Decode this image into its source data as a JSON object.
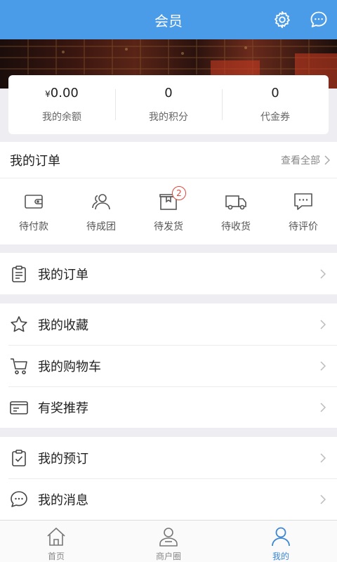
{
  "header": {
    "title": "会员",
    "settings_icon": "gear-icon",
    "message_icon": "chat-bubble-icon",
    "bg_color": "#4a9be8"
  },
  "account": {
    "balance": {
      "currency": "¥",
      "value": "0.00",
      "label": "我的余额"
    },
    "points": {
      "value": "0",
      "label": "我的积分"
    },
    "vouchers": {
      "value": "0",
      "label": "代金券"
    }
  },
  "orders": {
    "title": "我的订单",
    "view_all": "查看全部",
    "statuses": [
      {
        "label": "待付款",
        "icon": "wallet-icon"
      },
      {
        "label": "待成团",
        "icon": "group-icon"
      },
      {
        "label": "待发货",
        "icon": "package-icon",
        "badge": "2"
      },
      {
        "label": "待收货",
        "icon": "truck-icon"
      },
      {
        "label": "待评价",
        "icon": "comment-icon"
      }
    ]
  },
  "menu": {
    "my_orders": "我的订单",
    "favorites": "我的收藏",
    "cart": "我的购物车",
    "referral": "有奖推荐",
    "reservations": "我的预订",
    "messages": "我的消息"
  },
  "tabbar": {
    "home": "首页",
    "merchants": "商户圈",
    "mine": "我的",
    "active": "mine",
    "active_color": "#3a86d6"
  }
}
